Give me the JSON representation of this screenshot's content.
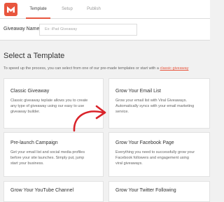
{
  "header": {
    "tabs": [
      {
        "label": "Template"
      },
      {
        "label": "Setup"
      },
      {
        "label": "Publish"
      }
    ]
  },
  "giveaway": {
    "label": "Giveaway Name",
    "placeholder": "Ex: iPad Giveaway"
  },
  "section": {
    "title": "Select a Template",
    "desc": "To speed up the process, you can select from one of our pre-made templates or start with a",
    "link": "classic giveaway"
  },
  "templates": [
    {
      "title": "Classic Giveaway",
      "lines": [
        "Classic giveaway teplate allows you to create",
        "any type of giveaway using our easy to use",
        "giveaway builder."
      ]
    },
    {
      "title": "Grow Your Email List",
      "lines": [
        "Grow your email list with Viral Giveaways.",
        "Automatically syncs with your email marketing",
        "service."
      ]
    },
    {
      "title": "Pre-launch Campaign",
      "lines": [
        "Get your email list and social media profiles",
        "before your site launches. Simply put, jump",
        "start your business."
      ]
    },
    {
      "title": "Grow Your Facebook Page",
      "lines": [
        "Everything you need to successfully grow your",
        "Facebook followers and engagement using",
        "viral giveaways."
      ]
    },
    {
      "title": "Grow Your YouTube Channel",
      "lines": []
    },
    {
      "title": "Grow Your Twitter Following",
      "lines": []
    }
  ],
  "colors": {
    "accent": "#e8563e",
    "annotation_arrow": "#d9232a"
  }
}
